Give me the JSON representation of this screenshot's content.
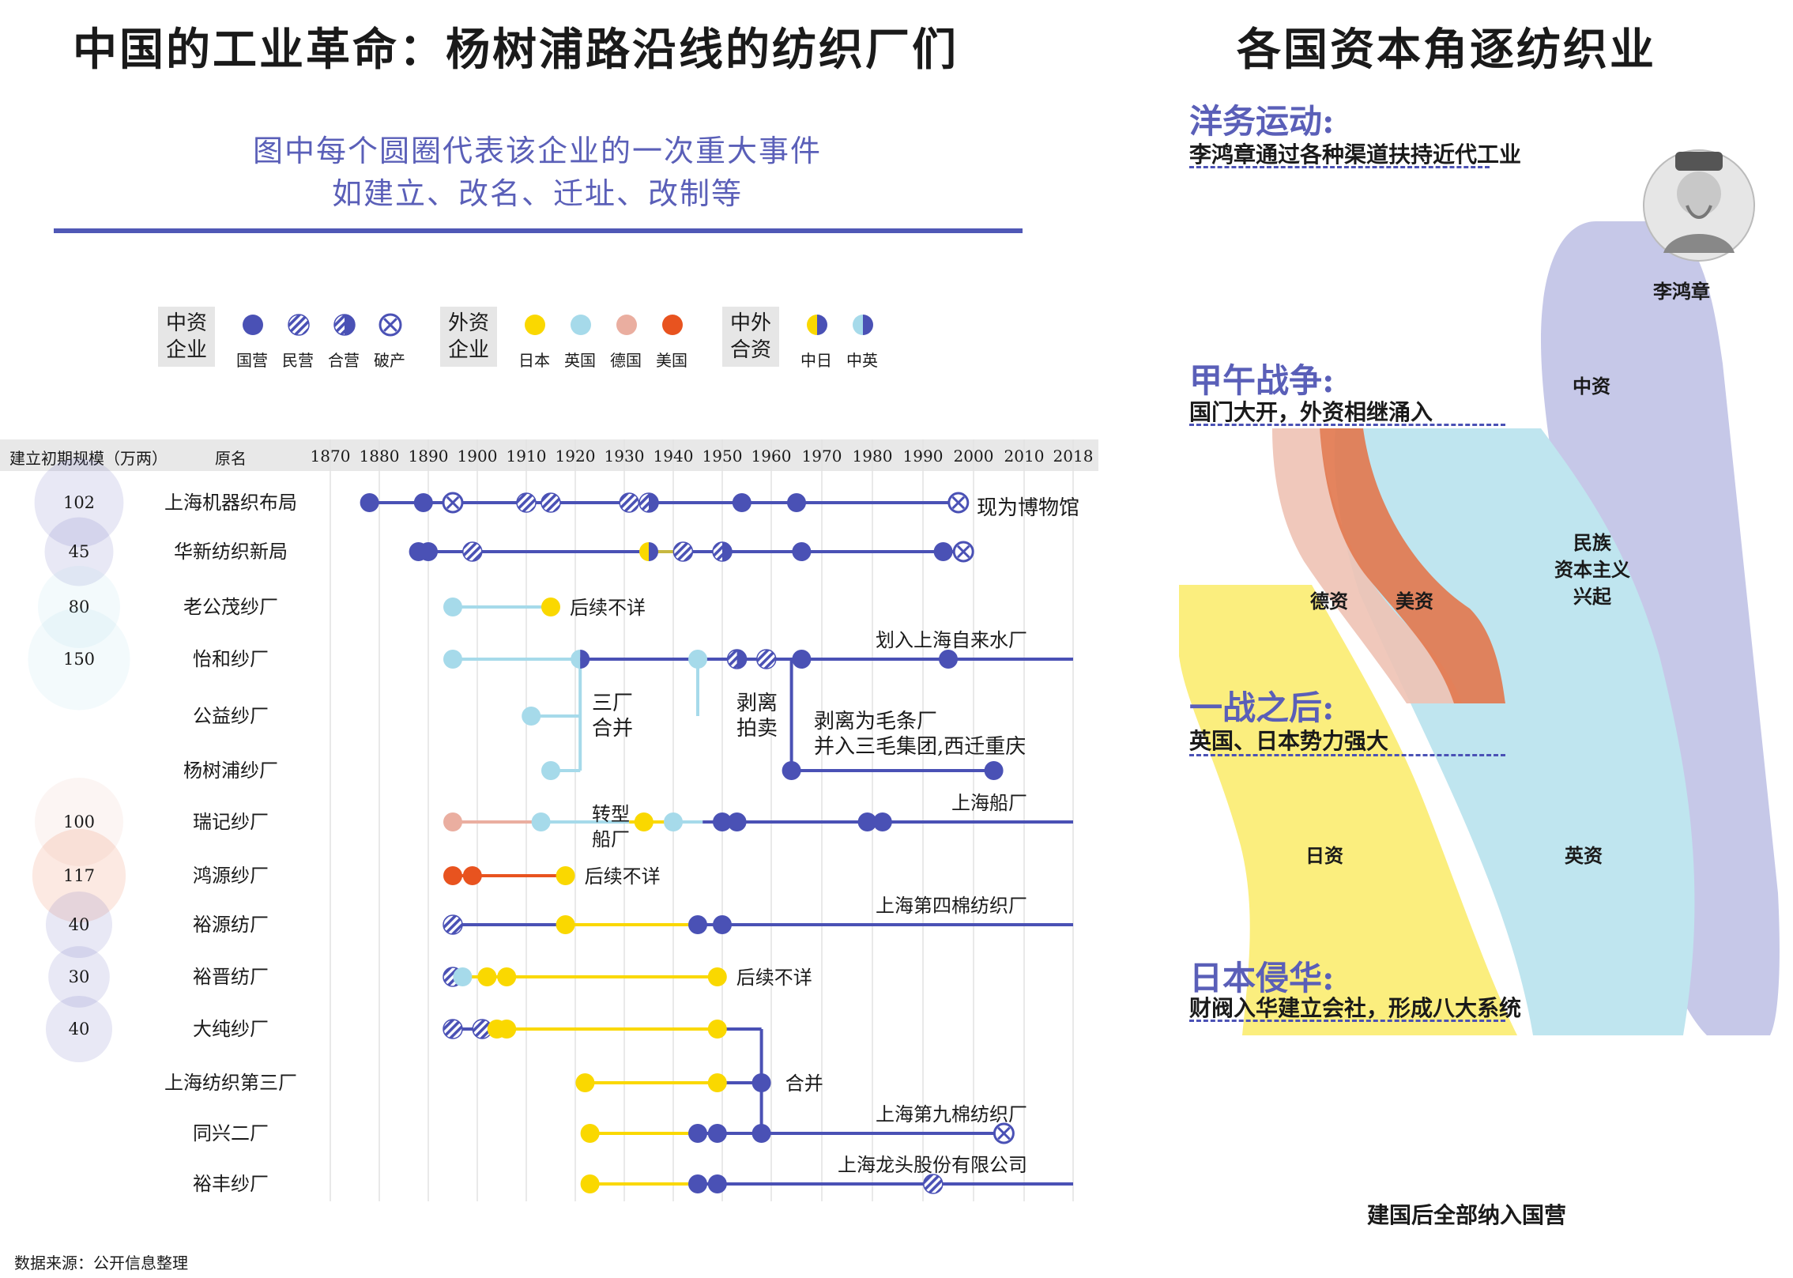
{
  "titles": {
    "left": "中国的工业革命：杨树浦路沿线的纺织厂们",
    "right": "各国资本角逐纺织业",
    "subtitle_line1": "图中每个圆圈代表该企业的一次重大事件",
    "subtitle_line2": "如建立、改名、迁址、改制等"
  },
  "legend": {
    "groups": [
      {
        "label_line1": "中资",
        "label_line2": "企业",
        "items": [
          {
            "label": "国营",
            "style": "solid",
            "color": "#4a51b5"
          },
          {
            "label": "民营",
            "style": "hatch",
            "color": "#4a51b5"
          },
          {
            "label": "合营",
            "style": "halfhatch",
            "color": "#4a51b5"
          },
          {
            "label": "破产",
            "style": "cross",
            "color": "#4a51b5"
          }
        ]
      },
      {
        "label_line1": "外资",
        "label_line2": "企业",
        "items": [
          {
            "label": "日本",
            "style": "solid",
            "color": "#fad800"
          },
          {
            "label": "英国",
            "style": "solid",
            "color": "#a6daea"
          },
          {
            "label": "德国",
            "style": "solid",
            "color": "#eaaea0"
          },
          {
            "label": "美国",
            "style": "solid",
            "color": "#e8531f"
          }
        ]
      },
      {
        "label_line1": "中外",
        "label_line2": "合资",
        "items": [
          {
            "label": "中日",
            "style": "half",
            "color": "#fad800",
            "color2": "#4a51b5"
          },
          {
            "label": "中英",
            "style": "half",
            "color": "#a6daea",
            "color2": "#4a51b5"
          }
        ]
      }
    ]
  },
  "table_header": {
    "scale_label": "建立初期规模（万两）",
    "name_label": "原名"
  },
  "colors": {
    "state": "#4a51b5",
    "japan": "#fad800",
    "uk": "#a6daea",
    "germany": "#eaaea0",
    "usa": "#e8531f"
  },
  "chart_data": {
    "type": "timeline",
    "x_ticks": [
      1870,
      1880,
      1890,
      1900,
      1910,
      1920,
      1930,
      1940,
      1950,
      1960,
      1970,
      1980,
      1990,
      2000,
      2010,
      2018
    ],
    "xlim": [
      1870,
      2018
    ],
    "rows": [
      {
        "name": "上海机器织布局",
        "scale": "102",
        "scale_value": 102,
        "scale_color": "#4a51b5",
        "segments": [
          {
            "from": 1878,
            "to": 1997,
            "color": "#4a51b5"
          }
        ],
        "events": [
          {
            "year": 1878,
            "style": "solid",
            "color": "#4a51b5"
          },
          {
            "year": 1889,
            "style": "solid",
            "color": "#4a51b5"
          },
          {
            "year": 1895,
            "style": "cross",
            "color": "#4a51b5"
          },
          {
            "year": 1910,
            "style": "hatch",
            "color": "#4a51b5"
          },
          {
            "year": 1915,
            "style": "hatch",
            "color": "#4a51b5"
          },
          {
            "year": 1931,
            "style": "hatch",
            "color": "#4a51b5"
          },
          {
            "year": 1935,
            "style": "halfhatch",
            "color": "#4a51b5"
          },
          {
            "year": 1954,
            "style": "solid",
            "color": "#4a51b5"
          },
          {
            "year": 1965,
            "style": "solid",
            "color": "#4a51b5"
          },
          {
            "year": 1997,
            "style": "cross",
            "color": "#4a51b5"
          }
        ]
      },
      {
        "name": "华新纺织新局",
        "scale": "45",
        "scale_value": 45,
        "scale_color": "#4a51b5",
        "segments": [
          {
            "from": 1888,
            "to": 1934,
            "color": "#4a51b5"
          },
          {
            "from": 1934,
            "to": 1941,
            "color": "#c7b840"
          },
          {
            "from": 1941,
            "to": 1999,
            "color": "#4a51b5"
          }
        ],
        "events": [
          {
            "year": 1888,
            "style": "solid",
            "color": "#4a51b5"
          },
          {
            "year": 1890,
            "style": "solid",
            "color": "#4a51b5"
          },
          {
            "year": 1899,
            "style": "hatch",
            "color": "#4a51b5"
          },
          {
            "year": 1935,
            "style": "half",
            "color": "#fad800",
            "color2": "#4a51b5"
          },
          {
            "year": 1942,
            "style": "hatch",
            "color": "#4a51b5"
          },
          {
            "year": 1950,
            "style": "halfhatch",
            "color": "#4a51b5"
          },
          {
            "year": 1966,
            "style": "solid",
            "color": "#4a51b5"
          },
          {
            "year": 1994,
            "style": "solid",
            "color": "#4a51b5"
          },
          {
            "year": 1998,
            "style": "cross",
            "color": "#4a51b5"
          }
        ]
      },
      {
        "name": "老公茂纱厂",
        "scale": "80",
        "scale_value": 80,
        "scale_color": "#a6daea",
        "segments": [
          {
            "from": 1895,
            "to": 1915,
            "color": "#a6daea"
          }
        ],
        "events": [
          {
            "year": 1895,
            "style": "solid",
            "color": "#a6daea"
          },
          {
            "year": 1915,
            "style": "solid",
            "color": "#fad800"
          }
        ],
        "note": "后续不详",
        "note_year": 1915
      },
      {
        "name": "怡和纱厂",
        "scale": "150",
        "scale_value": 150,
        "scale_color": "#a6daea",
        "segments": [
          {
            "from": 1895,
            "to": 1921,
            "color": "#a6daea"
          },
          {
            "from": 1921,
            "to": 2018,
            "color": "#4a51b5"
          }
        ],
        "events": [
          {
            "year": 1895,
            "style": "solid",
            "color": "#a6daea"
          },
          {
            "year": 1921,
            "style": "half",
            "color": "#a6daea",
            "color2": "#4a51b5"
          },
          {
            "year": 1945,
            "style": "solid",
            "color": "#a6daea"
          },
          {
            "year": 1953,
            "style": "halfhatch",
            "color": "#4a51b5"
          },
          {
            "year": 1959,
            "style": "hatch",
            "color": "#4a51b5"
          },
          {
            "year": 1966,
            "style": "solid",
            "color": "#4a51b5"
          },
          {
            "year": 1995,
            "style": "solid",
            "color": "#4a51b5"
          }
        ],
        "top_note": "划入上海自来水厂"
      },
      {
        "name": "公益纱厂",
        "scale": "",
        "scale_value": 0,
        "scale_color": "#ffffff",
        "segments": [
          {
            "from": 1911,
            "to": 1921,
            "color": "#a6daea"
          }
        ],
        "events": [
          {
            "year": 1911,
            "style": "solid",
            "color": "#a6daea"
          }
        ]
      },
      {
        "name": "杨树浦纱厂",
        "scale": "",
        "scale_value": 0,
        "scale_color": "#ffffff",
        "segments": [
          {
            "from": 1915,
            "to": 1921,
            "color": "#a6daea"
          },
          {
            "from": 1964,
            "to": 2004,
            "color": "#4a51b5"
          }
        ],
        "events": [
          {
            "year": 1915,
            "style": "solid",
            "color": "#a6daea"
          },
          {
            "year": 1964,
            "style": "solid",
            "color": "#4a51b5"
          },
          {
            "year": 2004,
            "style": "solid",
            "color": "#4a51b5"
          }
        ]
      },
      {
        "name": "瑞记纱厂",
        "scale": "100",
        "scale_value": 100,
        "scale_color": "#eaaea0",
        "segments": [
          {
            "from": 1895,
            "to": 1913,
            "color": "#eaaea0"
          },
          {
            "from": 1913,
            "to": 1931,
            "color": "#a6daea"
          },
          {
            "from": 1931,
            "to": 1940,
            "color": "#fad800"
          },
          {
            "from": 1940,
            "to": 1946,
            "color": "#a6daea"
          },
          {
            "from": 1946,
            "to": 2018,
            "color": "#4a51b5"
          }
        ],
        "events": [
          {
            "year": 1895,
            "style": "solid",
            "color": "#eaaea0"
          },
          {
            "year": 1913,
            "style": "solid",
            "color": "#a6daea"
          },
          {
            "year": 1934,
            "style": "solid",
            "color": "#fad800"
          },
          {
            "year": 1940,
            "style": "solid",
            "color": "#a6daea"
          },
          {
            "year": 1950,
            "style": "solid",
            "color": "#4a51b5"
          },
          {
            "year": 1953,
            "style": "solid",
            "color": "#4a51b5"
          },
          {
            "year": 1979,
            "style": "solid",
            "color": "#4a51b5"
          },
          {
            "year": 1982,
            "style": "solid",
            "color": "#4a51b5"
          }
        ],
        "top_note": "上海船厂"
      },
      {
        "name": "鸿源纱厂",
        "scale": "117",
        "scale_value": 117,
        "scale_color": "#e8531f",
        "segments": [
          {
            "from": 1895,
            "to": 1918,
            "color": "#e8531f"
          }
        ],
        "events": [
          {
            "year": 1895,
            "style": "solid",
            "color": "#e8531f"
          },
          {
            "year": 1899,
            "style": "solid",
            "color": "#e8531f"
          },
          {
            "year": 1918,
            "style": "solid",
            "color": "#fad800"
          }
        ],
        "note": "后续不详",
        "note_year": 1918
      },
      {
        "name": "裕源纺厂",
        "scale": "40",
        "scale_value": 40,
        "scale_color": "#4a51b5",
        "segments": [
          {
            "from": 1895,
            "to": 1917,
            "color": "#4a51b5"
          },
          {
            "from": 1917,
            "to": 1945,
            "color": "#fad800"
          },
          {
            "from": 1945,
            "to": 2018,
            "color": "#4a51b5"
          }
        ],
        "events": [
          {
            "year": 1895,
            "style": "hatch",
            "color": "#4a51b5"
          },
          {
            "year": 1918,
            "style": "solid",
            "color": "#fad800"
          },
          {
            "year": 1945,
            "style": "solid",
            "color": "#4a51b5"
          },
          {
            "year": 1950,
            "style": "solid",
            "color": "#4a51b5"
          }
        ],
        "top_note": "上海第四棉纺织厂"
      },
      {
        "name": "裕晋纺厂",
        "scale": "30",
        "scale_value": 30,
        "scale_color": "#4a51b5",
        "segments": [
          {
            "from": 1895,
            "to": 1949,
            "color": "#fad800"
          }
        ],
        "events": [
          {
            "year": 1895,
            "style": "hatch",
            "color": "#4a51b5"
          },
          {
            "year": 1897,
            "style": "solid",
            "color": "#a6daea"
          },
          {
            "year": 1902,
            "style": "solid",
            "color": "#fad800"
          },
          {
            "year": 1906,
            "style": "solid",
            "color": "#fad800"
          },
          {
            "year": 1949,
            "style": "solid",
            "color": "#fad800"
          }
        ],
        "note": "后续不详",
        "note_year": 1949
      },
      {
        "name": "大纯纱厂",
        "scale": "40",
        "scale_value": 40,
        "scale_color": "#4a51b5",
        "segments": [
          {
            "from": 1895,
            "to": 1904,
            "color": "#4a51b5"
          },
          {
            "from": 1904,
            "to": 1949,
            "color": "#fad800"
          },
          {
            "from": 1949,
            "to": 1958,
            "color": "#4a51b5"
          }
        ],
        "events": [
          {
            "year": 1895,
            "style": "hatch",
            "color": "#4a51b5"
          },
          {
            "year": 1901,
            "style": "hatch",
            "color": "#4a51b5"
          },
          {
            "year": 1904,
            "style": "solid",
            "color": "#fad800"
          },
          {
            "year": 1906,
            "style": "solid",
            "color": "#fad800"
          },
          {
            "year": 1949,
            "style": "solid",
            "color": "#fad800"
          }
        ]
      },
      {
        "name": "上海纺织第三厂",
        "scale": "",
        "scale_value": 0,
        "scale_color": "#ffffff",
        "segments": [
          {
            "from": 1922,
            "to": 1949,
            "color": "#fad800"
          },
          {
            "from": 1949,
            "to": 1958,
            "color": "#4a51b5"
          }
        ],
        "events": [
          {
            "year": 1922,
            "style": "solid",
            "color": "#fad800"
          },
          {
            "year": 1949,
            "style": "solid",
            "color": "#fad800"
          },
          {
            "year": 1958,
            "style": "solid",
            "color": "#4a51b5"
          }
        ],
        "note": "合并",
        "note_year": 1959
      },
      {
        "name": "同兴二厂",
        "scale": "",
        "scale_value": 0,
        "scale_color": "#ffffff",
        "segments": [
          {
            "from": 1923,
            "to": 1945,
            "color": "#fad800"
          },
          {
            "from": 1945,
            "to": 2006,
            "color": "#4a51b5"
          }
        ],
        "events": [
          {
            "year": 1923,
            "style": "solid",
            "color": "#fad800"
          },
          {
            "year": 1945,
            "style": "solid",
            "color": "#4a51b5"
          },
          {
            "year": 1949,
            "style": "solid",
            "color": "#4a51b5"
          },
          {
            "year": 1958,
            "style": "solid",
            "color": "#4a51b5"
          },
          {
            "year": 2006,
            "style": "cross",
            "color": "#4a51b5"
          }
        ],
        "top_note": "上海第九棉纺织厂"
      },
      {
        "name": "裕丰纱厂",
        "scale": "",
        "scale_value": 0,
        "scale_color": "#ffffff",
        "segments": [
          {
            "from": 1923,
            "to": 1945,
            "color": "#fad800"
          },
          {
            "from": 1945,
            "to": 2018,
            "color": "#4a51b5"
          }
        ],
        "events": [
          {
            "year": 1923,
            "style": "solid",
            "color": "#fad800"
          },
          {
            "year": 1945,
            "style": "solid",
            "color": "#4a51b5"
          },
          {
            "year": 1949,
            "style": "solid",
            "color": "#4a51b5"
          },
          {
            "year": 1992,
            "style": "hatch",
            "color": "#4a51b5"
          }
        ],
        "top_note": "上海龙头股份有限公司"
      }
    ],
    "annotations": {
      "museum": "现为博物馆",
      "merge3_line1": "三厂",
      "merge3_line2": "合并",
      "sold_line1": "剥离",
      "sold_line2": "拍卖",
      "split_line1": "剥离为毛条厂",
      "split_line2": "并入三毛集团,西迁重庆",
      "ship_line1": "转型",
      "ship_line2": "船厂"
    }
  },
  "source": "数据来源：公开信息整理",
  "right_panel": {
    "eras": [
      {
        "title": "洋务运动:",
        "desc": "李鸿章通过各种渠道扶持近代工业"
      },
      {
        "title": "甲午战争:",
        "desc": "国门大开，外资相继涌入"
      },
      {
        "title": "一战之后:",
        "desc": "英国、日本势力强大"
      },
      {
        "title": "日本侵华:",
        "desc": "财阀入华建立会社，形成八大系统"
      }
    ],
    "portrait_caption": "李鸿章",
    "flows": {
      "china": "中资",
      "national_line1": "民族",
      "national_line2": "资本主义",
      "national_line3": "兴起",
      "germany": "德资",
      "usa": "美资",
      "japan": "日资",
      "uk": "英资"
    },
    "bottom_note": "建国后全部纳入国营"
  }
}
